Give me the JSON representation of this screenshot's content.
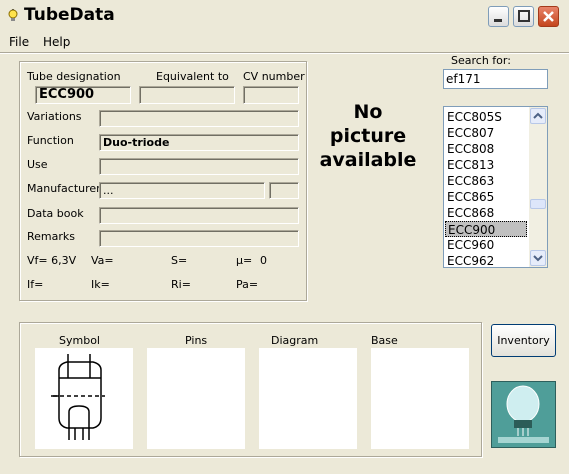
{
  "window": {
    "title": "TubeData"
  },
  "menu": {
    "file": "File",
    "help": "Help"
  },
  "details": {
    "tube_designation_label": "Tube designation",
    "equivalent_label": "Equivalent to",
    "cv_label": "CV number",
    "tube_designation": "ECC900",
    "equivalent": "",
    "cv_number": "",
    "variations_label": "Variations",
    "variations": "",
    "function_label": "Function",
    "function": "Duo-triode",
    "use_label": "Use",
    "use": "",
    "manufacturer_label": "Manufacturer",
    "manufacturer": "...",
    "manufacturer_code": "",
    "data_book_label": "Data book",
    "data_book": "",
    "remarks_label": "Remarks",
    "remarks": "",
    "vf": "Vf= 6,3V",
    "va": "Va=",
    "s": "S=",
    "mu_label": "µ=",
    "mu": "0",
    "if": "If=",
    "ik": "Ik=",
    "ri": "Ri=",
    "pa": "Pa="
  },
  "picture": {
    "line1": "No",
    "line2": "picture",
    "line3": "available"
  },
  "search": {
    "label": "Search for:",
    "value": "ef171"
  },
  "tube_list": {
    "items": [
      "ECC805S",
      "ECC807",
      "ECC808",
      "ECC813",
      "ECC863",
      "ECC865",
      "ECC868",
      "ECC900",
      "ECC960",
      "ECC962"
    ],
    "selected": "ECC900"
  },
  "bottom": {
    "symbol": "Symbol",
    "pins": "Pins",
    "diagram": "Diagram",
    "base": "Base"
  },
  "inventory_button": "Inventory",
  "icons": {
    "app": "lightbulb-icon",
    "min": "minimize-icon",
    "max": "maximize-icon",
    "close": "close-icon"
  },
  "colors": {
    "close_button": "#c4451d",
    "selection": "#c0c0c0",
    "logo_bg": "#3f8a86"
  }
}
